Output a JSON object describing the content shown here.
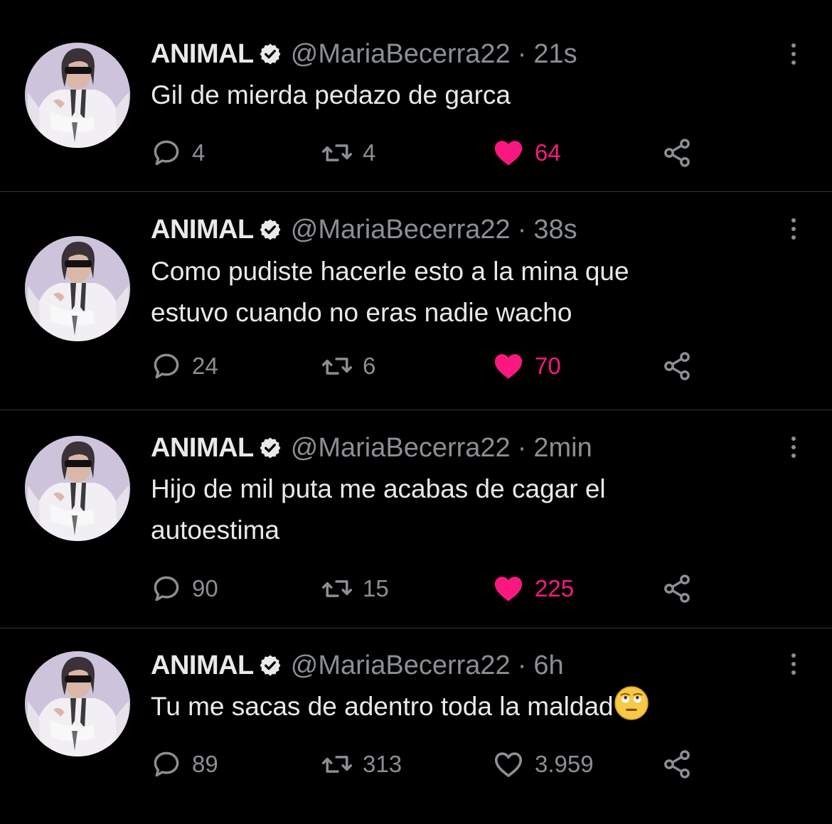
{
  "colors": {
    "background": "#000000",
    "text": "#e7e9ea",
    "muted": "#8b8f94",
    "like": "#f91880",
    "divider": "#2f3336"
  },
  "tweets": [
    {
      "name": "ANIMAL",
      "handle": "@MariaBecerra22",
      "separator": "·",
      "time": "21s",
      "text": "Gil de mierda pedazo de garca",
      "replies": "4",
      "retweets": "4",
      "likes": "64",
      "liked": true,
      "icons": {
        "reply": "reply-icon",
        "retweet": "retweet-icon",
        "like": "heart-filled-icon",
        "share": "share-icon",
        "more": "more-vertical-icon",
        "verified": "verified-badge-icon"
      }
    },
    {
      "name": "ANIMAL",
      "handle": "@MariaBecerra22",
      "separator": "·",
      "time": "38s",
      "text_line1": "Como pudiste hacerle esto a la mina que",
      "text_line2": "estuvo cuando no eras nadie wacho",
      "replies": "24",
      "retweets": "6",
      "likes": "70",
      "liked": true
    },
    {
      "name": "ANIMAL",
      "handle": "@MariaBecerra22",
      "separator": "·",
      "time": "2min",
      "text_line1": "Hijo de mil puta me acabas de cagar el",
      "text_line2": "autoestima",
      "replies": "90",
      "retweets": "15",
      "likes": "225",
      "liked": true
    },
    {
      "name": "ANIMAL",
      "handle": "@MariaBecerra22",
      "separator": "·",
      "time": "6h",
      "text": "Tu me sacas de adentro toda la maldad",
      "emoji": "face-with-rolling-eyes",
      "replies": "89",
      "retweets": "313",
      "likes": "3.959",
      "liked": false
    }
  ]
}
